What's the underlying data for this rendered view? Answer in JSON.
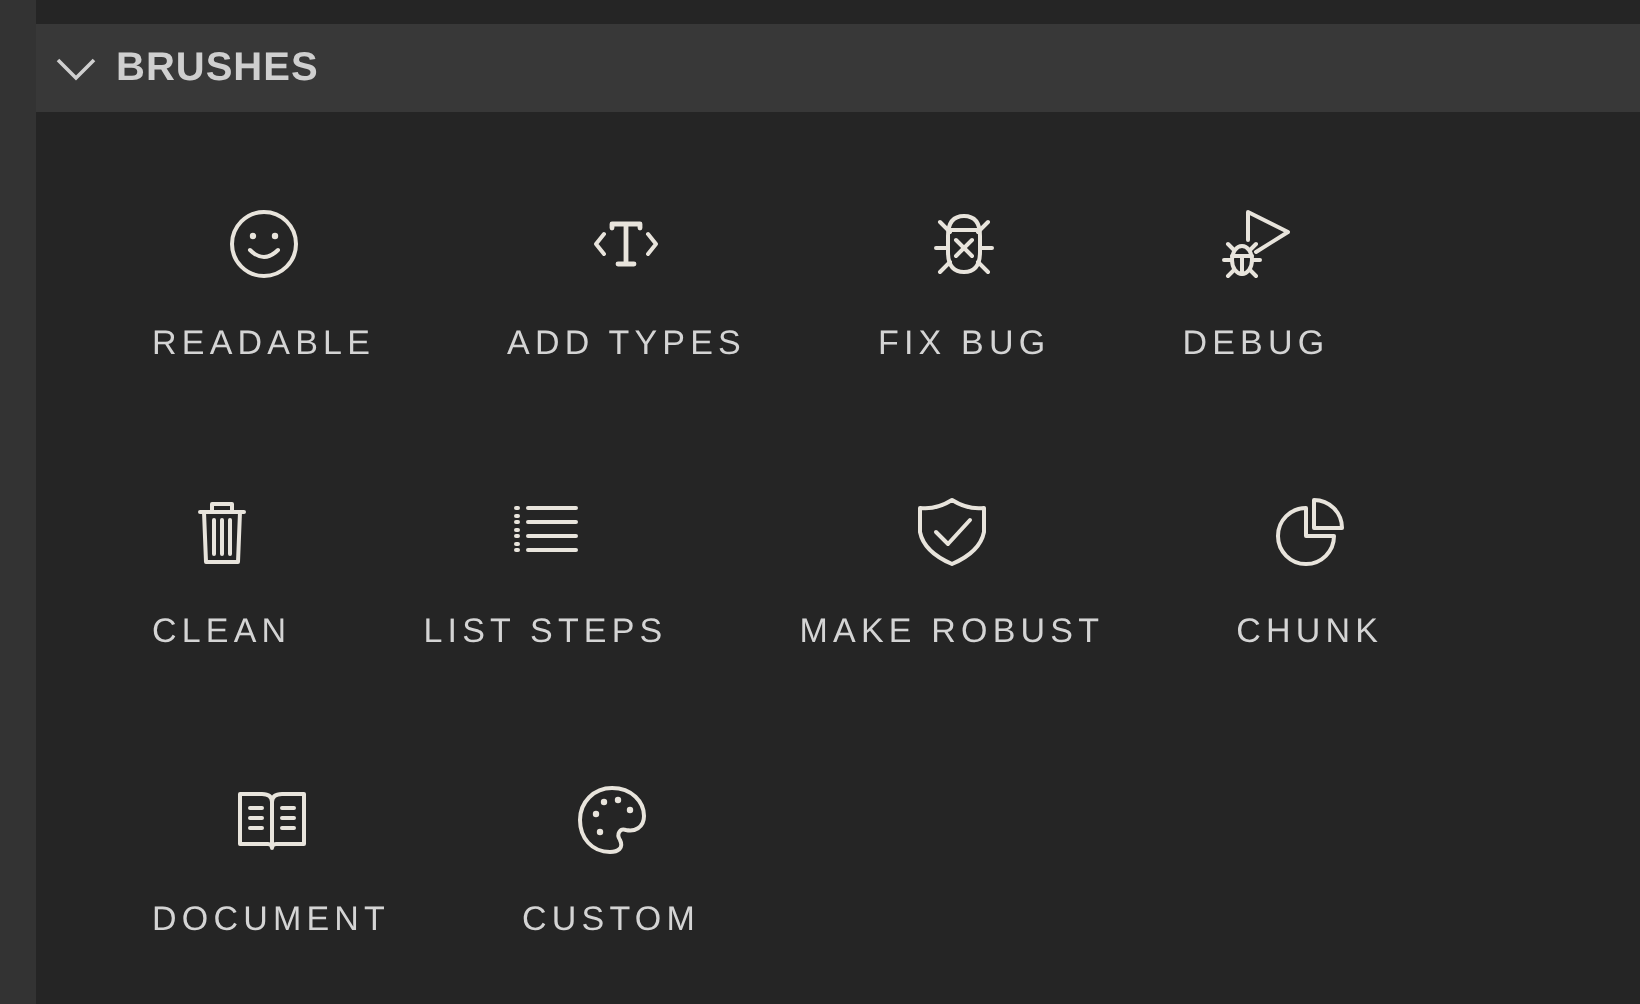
{
  "section": {
    "title": "BRUSHES",
    "expanded": true
  },
  "rows": [
    [
      {
        "label": "READABLE"
      },
      {
        "label": "ADD TYPES"
      },
      {
        "label": "FIX BUG"
      },
      {
        "label": "DEBUG"
      }
    ],
    [
      {
        "label": "CLEAN"
      },
      {
        "label": "LIST STEPS"
      },
      {
        "label": "MAKE ROBUST"
      },
      {
        "label": "CHUNK"
      }
    ],
    [
      {
        "label": "DOCUMENT"
      },
      {
        "label": "CUSTOM"
      }
    ]
  ]
}
